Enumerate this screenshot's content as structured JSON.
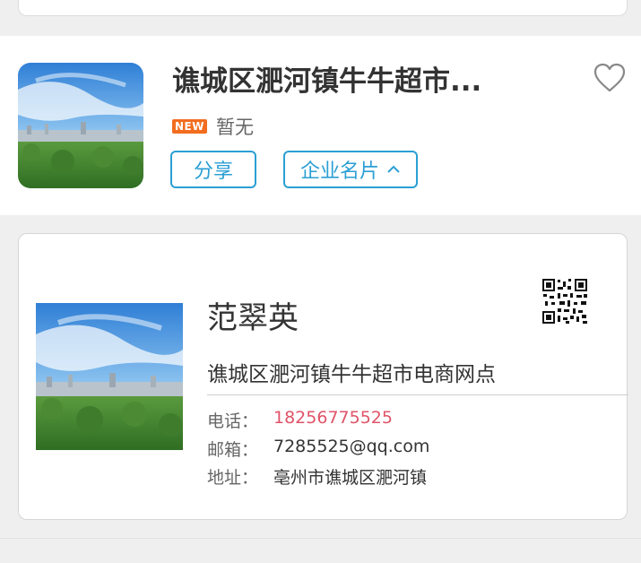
{
  "listing": {
    "title": "谯城区淝河镇牛牛超市...",
    "badge": "NEW",
    "status": "暂无",
    "share_label": "分享",
    "card_label": "企业名片",
    "favorite_icon": "heart-outline-icon",
    "expand_icon": "chevron-up-icon"
  },
  "namecard": {
    "name": "范翠英",
    "company": "谯城区淝河镇牛牛超市电商网点",
    "qr_icon": "qr-code-icon",
    "fields": [
      {
        "label": "电话：",
        "value": "18256775525"
      },
      {
        "label": "邮箱：",
        "value": "7285525@qq.com"
      },
      {
        "label": "地址：",
        "value": "亳州市谯城区淝河镇"
      }
    ]
  },
  "colors": {
    "accent": "#2b9fd4",
    "badge": "#f26d1f",
    "phone": "#e05469",
    "background": "#efefef"
  }
}
